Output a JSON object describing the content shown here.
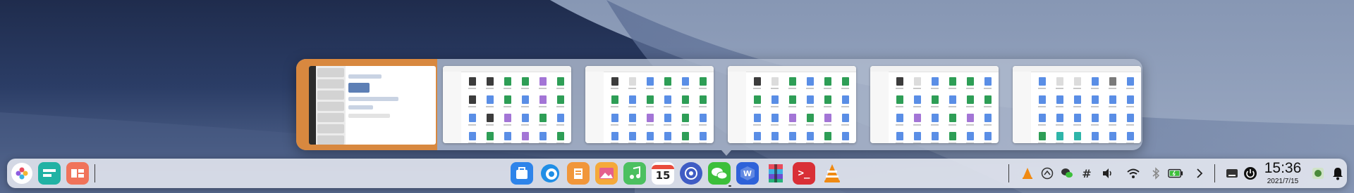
{
  "desktop": {
    "wallpaper": "sand-dunes-night"
  },
  "switcher": {
    "windows": [
      {
        "app": "chat-app",
        "active": true
      },
      {
        "app": "file-manager"
      },
      {
        "app": "file-manager"
      },
      {
        "app": "file-manager"
      },
      {
        "app": "file-manager"
      },
      {
        "app": "file-manager"
      }
    ]
  },
  "dock": {
    "left_icons": [
      "launcher-icon",
      "multitask-view-icon",
      "workspace-icon"
    ],
    "apps": [
      "app-store-icon",
      "browser-icon",
      "notes-icon",
      "image-viewer-icon",
      "music-icon",
      "calendar-icon",
      "control-center-icon",
      "wechat-icon",
      "wps-office-icon",
      "archive-manager-icon",
      "terminal-icon",
      "vlc-icon"
    ],
    "calendar_day": "15",
    "tray": [
      "vlc-tray-icon",
      "network-monitor-icon",
      "wechat-tray-icon",
      "grid-tray-icon",
      "volume-icon",
      "wifi-icon",
      "bluetooth-icon",
      "battery-icon",
      "expand-icon",
      "keyboard-icon",
      "power-icon"
    ],
    "clock": {
      "time": "15:36",
      "date": "2021/7/15"
    },
    "colors": {
      "accent_active": "#d8883f",
      "vlc": "#f08a12",
      "terminal": "#d92f36",
      "wechat": "#3cbf3a",
      "wps": "#2e62d9"
    }
  }
}
